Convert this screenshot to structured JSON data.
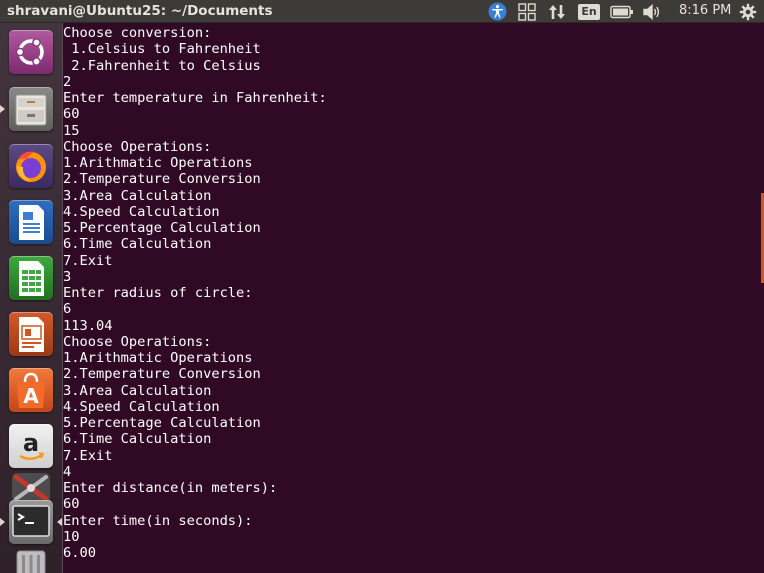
{
  "top_panel": {
    "window_title": "shravani@Ubuntu25: ~/Documents",
    "keyboard_layout": "En",
    "clock": "8:16 PM",
    "icons": [
      "accessibility-icon",
      "workspace-switcher-icon",
      "network-icon",
      "keyboard-layout-indicator",
      "battery-icon",
      "volume-icon",
      "settings-gear-icon"
    ]
  },
  "launcher": {
    "items": [
      {
        "name": "ubuntu-dash-button",
        "icon": "ubuntu-logo-icon"
      },
      {
        "name": "files-launcher",
        "icon": "file-cabinet-icon"
      },
      {
        "name": "firefox-launcher",
        "icon": "firefox-icon"
      },
      {
        "name": "libreoffice-writer-launcher",
        "icon": "writer-document-icon"
      },
      {
        "name": "libreoffice-calc-launcher",
        "icon": "calc-spreadsheet-icon"
      },
      {
        "name": "libreoffice-impress-launcher",
        "icon": "impress-presentation-icon"
      },
      {
        "name": "ubuntu-software-launcher",
        "icon": "software-bag-icon"
      },
      {
        "name": "amazon-launcher",
        "icon": "amazon-icon"
      },
      {
        "name": "system-settings-launcher",
        "icon": "settings-tools-icon"
      },
      {
        "name": "terminal-launcher",
        "icon": "terminal-icon"
      },
      {
        "name": "trash-launcher",
        "icon": "trash-icon"
      }
    ]
  },
  "terminal": {
    "lines": [
      "Choose conversion:",
      " 1.Celsius to Fahrenheit",
      " 2.Fahrenheit to Celsius",
      "2",
      "Enter temperature in Fahrenheit:",
      "60",
      "15",
      "Choose Operations:",
      "1.Arithmatic Operations",
      "2.Temperature Conversion",
      "3.Area Calculation",
      "4.Speed Calculation",
      "5.Percentage Calculation",
      "6.Time Calculation",
      "7.Exit",
      "3",
      "Enter radius of circle:",
      "6",
      "113.04",
      "Choose Operations:",
      "1.Arithmatic Operations",
      "2.Temperature Conversion",
      "3.Area Calculation",
      "4.Speed Calculation",
      "5.Percentage Calculation",
      "6.Time Calculation",
      "7.Exit",
      "4",
      "Enter distance(in meters):",
      "60",
      "Enter time(in seconds):",
      "10",
      "6.00"
    ]
  },
  "colors": {
    "terminal_bg": "#300a24",
    "panel_bg": "#3c3b37",
    "accent": "#e95420"
  }
}
